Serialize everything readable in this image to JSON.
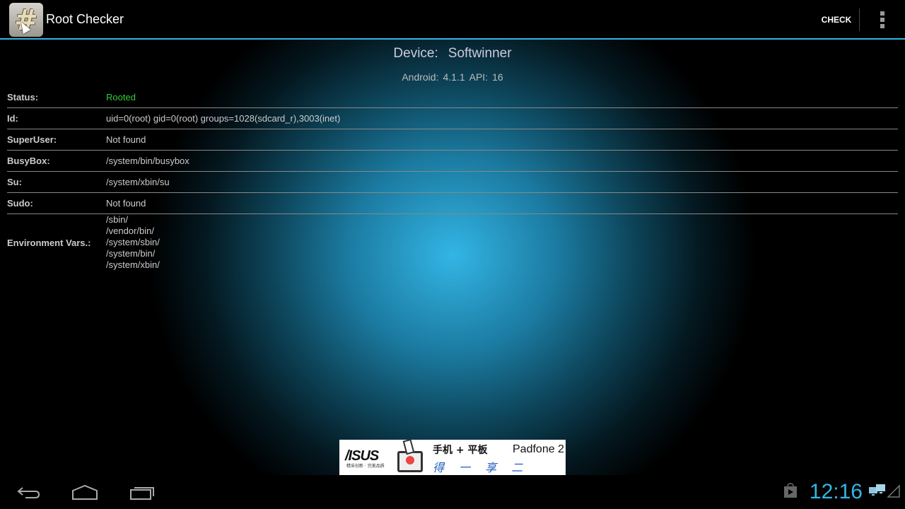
{
  "action_bar": {
    "app_icon": "hash-icon",
    "title": "Root Checker",
    "check_label": "CHECK",
    "overflow_icon": "overflow-menu-icon"
  },
  "device": {
    "label": "Device:",
    "name": "Softwinner",
    "android_label": "Android:",
    "android_version": "4.1.1",
    "api_label": "API:",
    "api_level": "16"
  },
  "rows": [
    {
      "label": "Status:",
      "value": "Rooted",
      "color": "#33cc33"
    },
    {
      "label": "Id:",
      "value": "uid=0(root) gid=0(root) groups=1028(sdcard_r),3003(inet)"
    },
    {
      "label": "SuperUser:",
      "value": "Not found"
    },
    {
      "label": "BusyBox:",
      "value": "/system/bin/busybox"
    },
    {
      "label": "Su:",
      "value": "/system/xbin/su"
    },
    {
      "label": "Sudo:",
      "value": "Not found"
    }
  ],
  "environment": {
    "label": "Environment Vars.:",
    "values": [
      "/sbin/",
      "/vendor/bin/",
      "/system/sbin/",
      "/system/bin/",
      "/system/xbin/"
    ]
  },
  "ad": {
    "brand": "/ISUS",
    "brand_sub": "精采创新 · 完美品质",
    "headline": "手机 + 平板",
    "tagline": "得 一 享 二",
    "product": "Padfone 2"
  },
  "nav_bar": {
    "back_icon": "back-icon",
    "home_icon": "home-icon",
    "recents_icon": "recent-apps-icon"
  },
  "status_bar": {
    "time": "12:16",
    "notification_icon": "play-store-icon",
    "network_icon": "ethernet-icon",
    "signal_icon": "signal-icon"
  },
  "colors": {
    "accent": "#33b5e5",
    "status_rooted": "#33cc33"
  }
}
